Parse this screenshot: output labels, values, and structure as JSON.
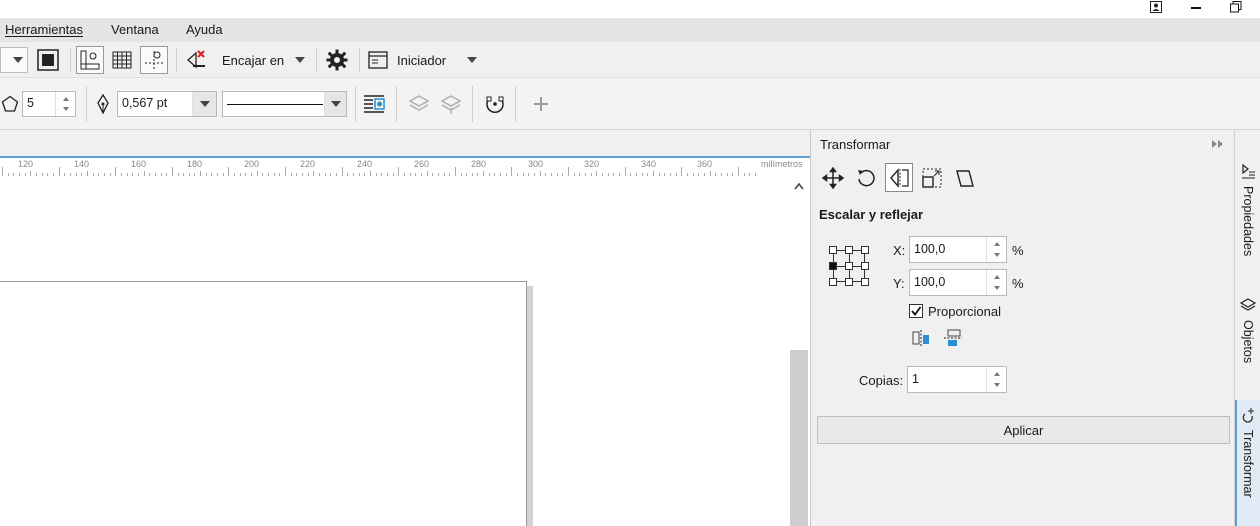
{
  "menu": {
    "items": [
      "Herramientas",
      "Ventana",
      "Ayuda"
    ]
  },
  "toolbar": {
    "snap_label": "Encajar en",
    "launcher_label": "Iniciador"
  },
  "properties": {
    "sides_value": "5",
    "outline_width": "0,567 pt"
  },
  "ruler": {
    "ticks": [
      "120",
      "140",
      "160",
      "180",
      "200",
      "220",
      "240",
      "260",
      "280",
      "300",
      "320",
      "340",
      "360"
    ],
    "unit": "milímetros"
  },
  "docker": {
    "title": "Transformar",
    "section_title": "Escalar y reflejar",
    "x_label": "X:",
    "x_value": "100,0",
    "y_label": "Y:",
    "y_value": "100,0",
    "percent": "%",
    "proportional_label": "Proporcional",
    "proportional_checked": true,
    "copies_label": "Copias:",
    "copies_value": "1",
    "apply_label": "Aplicar"
  },
  "side_tabs": [
    "Propiedades",
    "Objetos",
    "Transformar"
  ],
  "colors": {
    "accent": "#5aa0d8",
    "mirror_blue": "#2a8fd0",
    "delete_red": "#e02020"
  }
}
